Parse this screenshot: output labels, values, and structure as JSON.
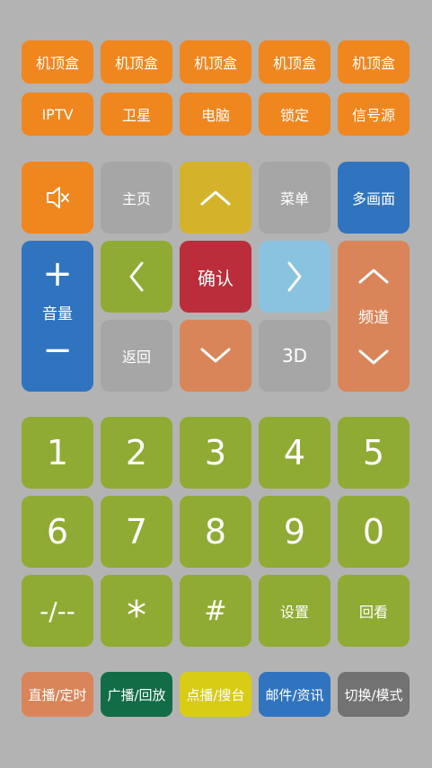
{
  "colors": {
    "background": "#b3b3b3",
    "orange": "#f0861e",
    "gray": "#a6a6a6",
    "mustard": "#d4b32a",
    "blue": "#3074bf",
    "olive": "#8fab33",
    "red": "#bb2d3a",
    "light_blue": "#8ac3e0",
    "salmon": "#d98559",
    "dark_green": "#126c46",
    "yellow": "#d9cc14",
    "dark_gray": "#727272"
  },
  "source_row": [
    "机顶盒",
    "机顶盒",
    "机顶盒",
    "机顶盒",
    "机顶盒"
  ],
  "input_row": [
    "IPTV",
    "卫星",
    "电脑",
    "锁定",
    "信号源"
  ],
  "nav": {
    "mute_icon": "speaker-mute-icon",
    "home": "主页",
    "up_icon": "chevron-up-icon",
    "menu": "菜单",
    "multiscreen": "多画面",
    "volume_plus": "+",
    "volume_label": "音量",
    "volume_minus": "−",
    "left_icon": "chevron-left-icon",
    "ok": "确认",
    "right_icon": "chevron-right-icon",
    "channel_up_icon": "chevron-up-icon",
    "channel_label": "频道",
    "channel_down_icon": "chevron-down-icon",
    "back": "返回",
    "down_icon": "chevron-down-icon",
    "three_d": "3D"
  },
  "keypad": [
    "1",
    "2",
    "3",
    "4",
    "5",
    "6",
    "7",
    "8",
    "9",
    "0",
    "-/--",
    "*",
    "#",
    "设置",
    "回看"
  ],
  "functions": [
    "直播/定时",
    "广播/回放",
    "点播/搜台",
    "邮件/资讯",
    "切换/模式"
  ]
}
